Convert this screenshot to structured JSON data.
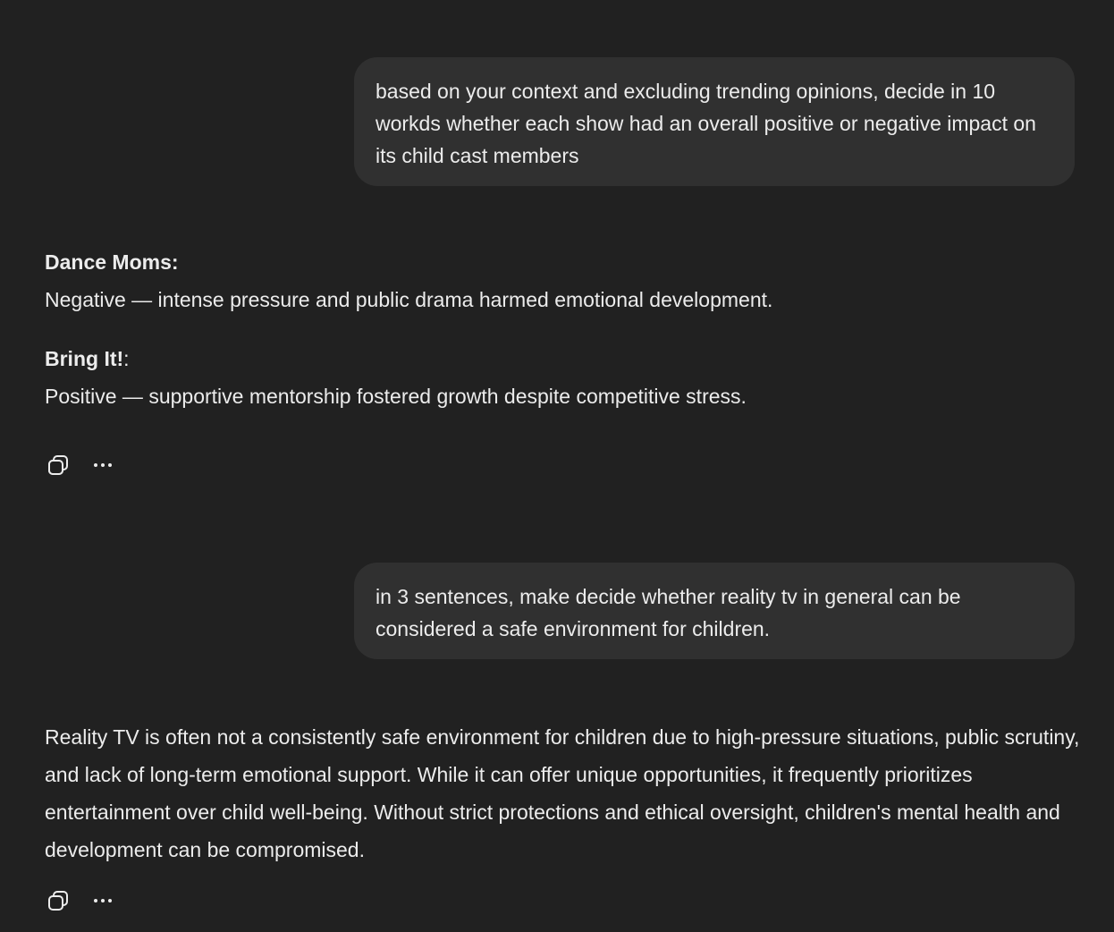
{
  "conversation": {
    "messages": [
      {
        "role": "user",
        "text": "based on your context and excluding trending opinions, decide in 10 workds whether each show had an overall positive or negative impact on its child cast members"
      },
      {
        "role": "assistant",
        "sections": [
          {
            "heading": "Dance Moms:",
            "text": "Negative — intense pressure and public drama harmed emotional development."
          },
          {
            "heading": "Bring It!",
            "heading_suffix": ":",
            "text": "Positive — supportive mentorship fostered growth despite competitive stress."
          }
        ]
      },
      {
        "role": "user",
        "text": "in 3 sentences, make decide whether reality tv in general can be considered a safe environment for children."
      },
      {
        "role": "assistant",
        "text": "Reality TV is often not a consistently safe environment for children due to high-pressure situations, public scrutiny, and lack of long-term emotional support. While it can offer unique opportunities, it frequently prioritizes entertainment over child well-being. Without strict protections and ethical oversight, children's mental health and development can be compromised."
      }
    ]
  },
  "actions": {
    "copy_icon": "copy-icon",
    "more_icon": "more-options-icon"
  },
  "colors": {
    "background": "#212121",
    "user_bubble": "#303030",
    "text": "#ececec"
  }
}
